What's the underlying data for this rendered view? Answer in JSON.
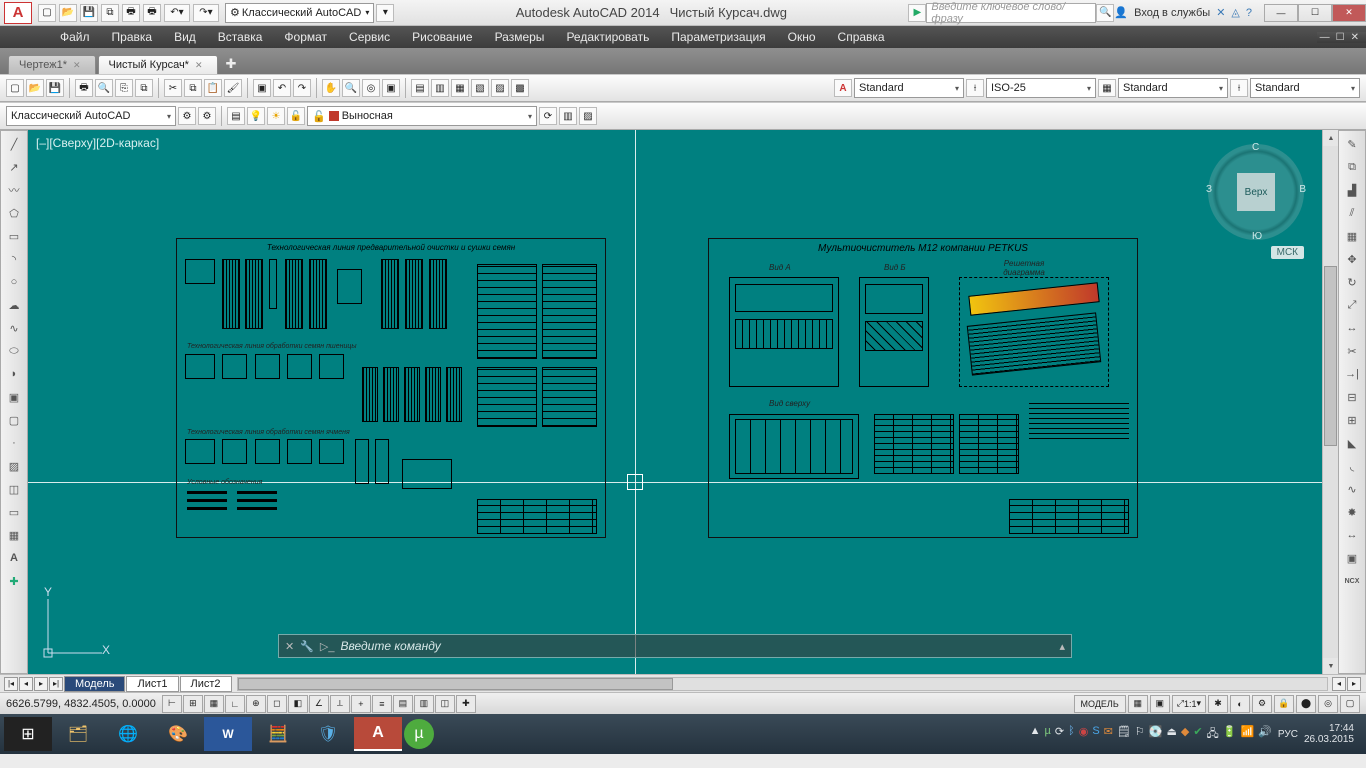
{
  "title": {
    "app": "Autodesk AutoCAD 2014",
    "doc": "Чистый Курсач.dwg",
    "workspace_dd": "Классический AutoCAD",
    "search_placeholder": "Введите ключевое слово/фразу",
    "signin": "Вход в службы"
  },
  "menu": [
    "Файл",
    "Правка",
    "Вид",
    "Вставка",
    "Формат",
    "Сервис",
    "Рисование",
    "Размеры",
    "Редактировать",
    "Параметризация",
    "Окно",
    "Справка"
  ],
  "doctabs": [
    {
      "label": "Чертеж1*",
      "active": false
    },
    {
      "label": "Чистый Курсач*",
      "active": true
    }
  ],
  "props": {
    "textstyle": "Standard",
    "dimstyle": "ISO-25",
    "tablestyle": "Standard",
    "mlstyle": "Standard"
  },
  "ws_row": {
    "workspace": "Классический AutoCAD",
    "layer": "Выносная"
  },
  "viewport": {
    "label": "[–][Сверху][2D-каркас]"
  },
  "ucs": {
    "y": "Y",
    "x": "X"
  },
  "navcube": {
    "top": "Верх",
    "n": "С",
    "s": "Ю",
    "w": "З",
    "e": "В",
    "wcs": "МСК"
  },
  "drawings": {
    "d1_title": "Технологическая линия предварительной очистки и сушки семян",
    "d1_title2": "Технологическая линия обработки семян пшеницы",
    "d1_title3": "Технологическая линия обработки семян ячменя",
    "d1_legend": "Условные обозначения",
    "d2_title": "Мультиочиститель М12 компании PETKUS",
    "d2_va": "Вид А",
    "d2_vb": "Вид Б",
    "d2_vc": "Решетная диаграмма",
    "d2_top": "Вид сверху"
  },
  "cmd": {
    "prompt": "Введите команду"
  },
  "layout_tabs": {
    "model": "Модель",
    "l1": "Лист1",
    "l2": "Лист2"
  },
  "status": {
    "coords": "6626.5799, 4832.4505, 0.0000",
    "model": "МОДЕЛЬ",
    "scale": "1:1"
  },
  "taskbar": {
    "lang": "РУС",
    "time": "17:44",
    "date": "26.03.2015"
  }
}
